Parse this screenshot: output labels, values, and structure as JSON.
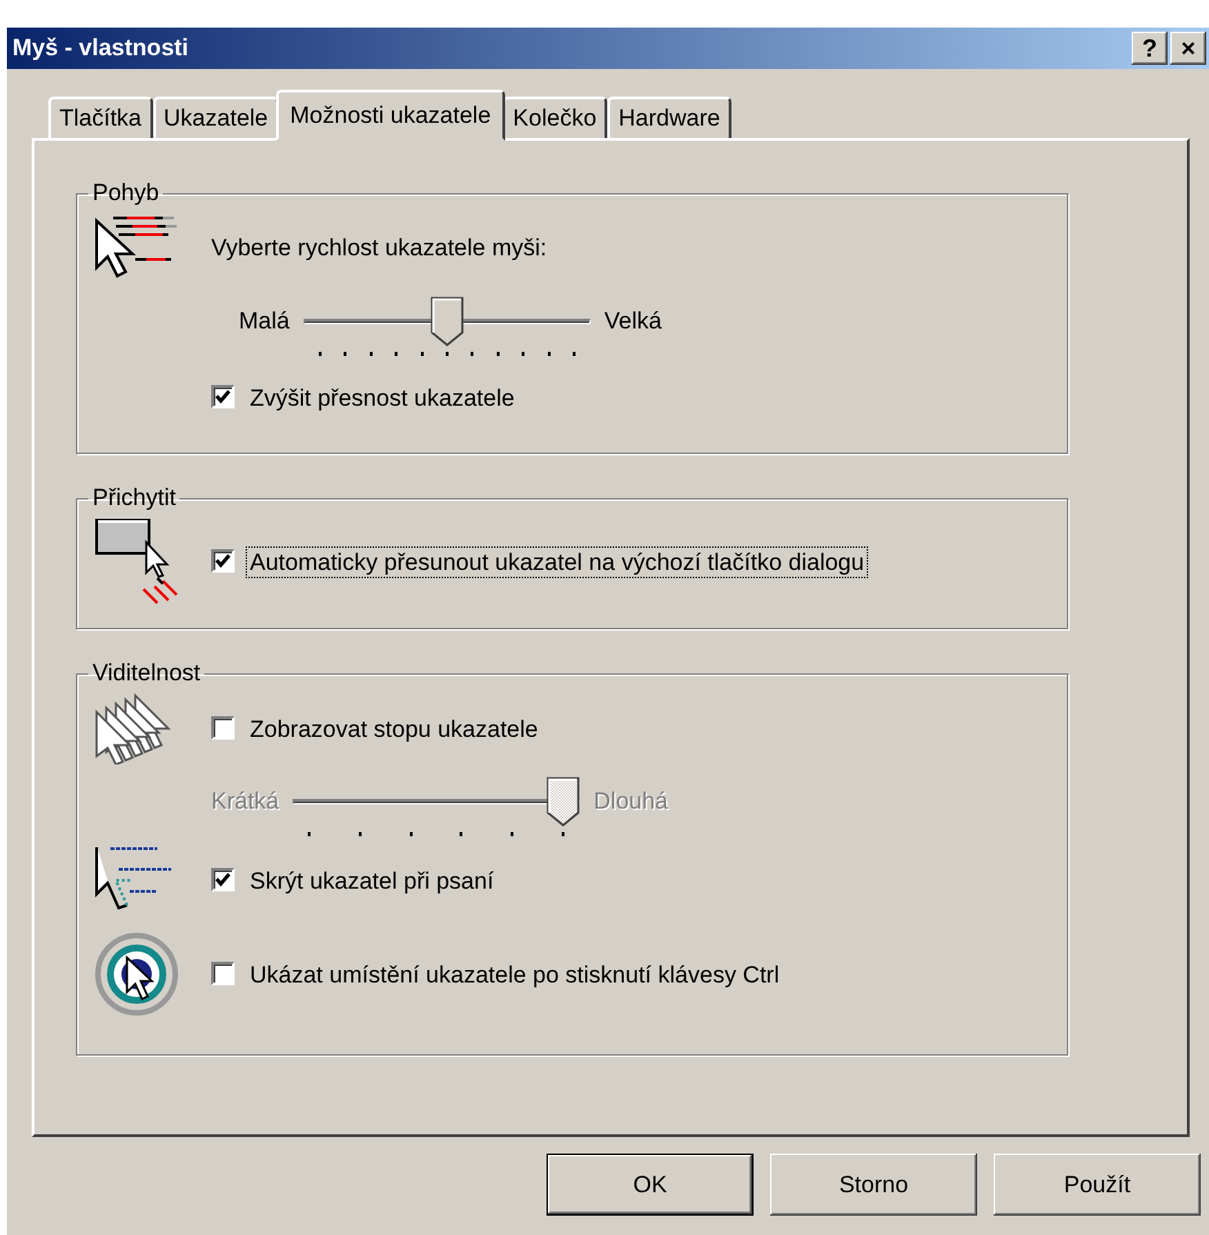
{
  "window": {
    "title": "Myš - vlastnosti",
    "controls": [
      "?",
      "×"
    ]
  },
  "tabs": [
    {
      "label": "Tlačítka",
      "selected": false
    },
    {
      "label": "Ukazatele",
      "selected": false
    },
    {
      "label": "Možnosti ukazatele",
      "selected": true
    },
    {
      "label": "Kolečko",
      "selected": false
    },
    {
      "label": "Hardware",
      "selected": false
    }
  ],
  "groups": [
    {
      "title": "Pohyb",
      "items": [
        {
          "kind": "text",
          "text": "Vyberte rychlost ukazatele myši:"
        },
        {
          "kind": "slider",
          "min_label": "Malá",
          "max_label": "Velká",
          "level": 0.5,
          "disabled": false
        },
        {
          "kind": "checkbox",
          "label": "Zvýšit přesnost ukazatele",
          "checked": true,
          "focused": false
        }
      ]
    },
    {
      "title": "Přichytit",
      "items": [
        {
          "kind": "checkbox",
          "label": "Automaticky přesunout ukazatel na výchozí tlačítko dialogu",
          "checked": true,
          "focused": true
        }
      ]
    },
    {
      "title": "Viditelnost",
      "items": [
        {
          "kind": "checkbox",
          "label": "Zobrazovat stopu ukazatele",
          "checked": false,
          "focused": false
        },
        {
          "kind": "slider",
          "min_label": "Krátká",
          "max_label": "Dlouhá",
          "level": 1,
          "disabled": true
        },
        {
          "kind": "checkbox",
          "label": "Skrýt ukazatel při psaní",
          "checked": true,
          "focused": false
        },
        {
          "kind": "checkbox",
          "label": "Ukázat umístění ukazatele po stisknutí klávesy Ctrl",
          "checked": false,
          "focused": false
        }
      ]
    }
  ],
  "buttons": [
    {
      "label": "OK",
      "default": true
    },
    {
      "label": "Storno",
      "default": false
    },
    {
      "label": "Použít",
      "default": false
    }
  ]
}
